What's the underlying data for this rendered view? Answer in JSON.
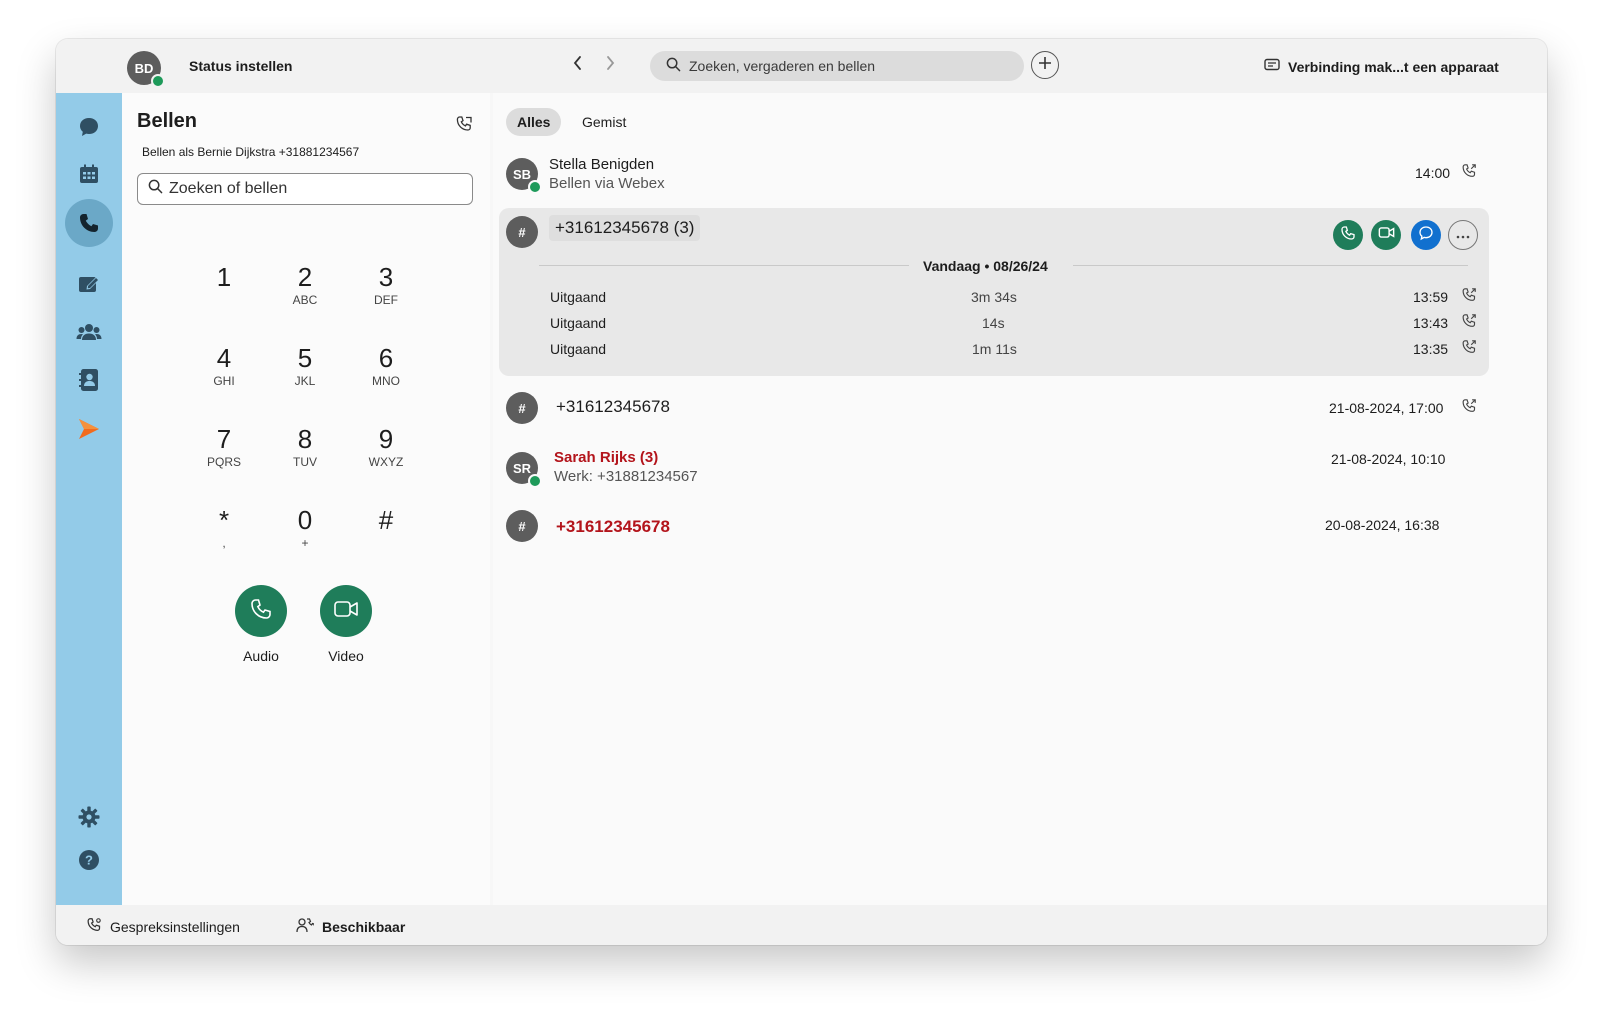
{
  "topbar": {
    "avatar_initials": "BD",
    "status_label": "Status instellen",
    "search_placeholder": "Zoeken, vergaderen en bellen",
    "connect_label": "Verbinding mak...t een apparaat"
  },
  "rail": {
    "items": [
      "messaging-icon",
      "calendar-icon",
      "calling-icon",
      "whiteboard-icon",
      "teams-icon",
      "contacts-icon",
      "webex-app-icon",
      "settings-icon",
      "help-icon"
    ],
    "active": "calling-icon"
  },
  "dialer": {
    "title": "Bellen",
    "calling_as": "Bellen als Bernie Dijkstra +31881234567",
    "search_placeholder": "Zoeken of bellen",
    "keys": [
      {
        "digit": "1",
        "letters": ""
      },
      {
        "digit": "2",
        "letters": "ABC"
      },
      {
        "digit": "3",
        "letters": "DEF"
      },
      {
        "digit": "4",
        "letters": "GHI"
      },
      {
        "digit": "5",
        "letters": "JKL"
      },
      {
        "digit": "6",
        "letters": "MNO"
      },
      {
        "digit": "7",
        "letters": "PQRS"
      },
      {
        "digit": "8",
        "letters": "TUV"
      },
      {
        "digit": "9",
        "letters": "WXYZ"
      },
      {
        "digit": "*",
        "letters": ","
      },
      {
        "digit": "0",
        "letters": "+"
      },
      {
        "digit": "#",
        "letters": ""
      }
    ],
    "audio_label": "Audio",
    "video_label": "Video"
  },
  "history": {
    "tabs": [
      "Alles",
      "Gemist"
    ],
    "active_tab": "Alles",
    "entries": [
      {
        "avatar": "SB",
        "name": "Stella Benigden",
        "sub": "Bellen via Webex",
        "time": "14:00",
        "missed": false
      },
      {
        "avatar": "#",
        "name": "+31612345678 (3)",
        "time": "",
        "missed": false,
        "date_header": "Vandaag • 08/26/24",
        "details": [
          {
            "type": "Uitgaand",
            "duration": "3m 34s",
            "time": "13:59"
          },
          {
            "type": "Uitgaand",
            "duration": "14s",
            "time": "13:43"
          },
          {
            "type": "Uitgaand",
            "duration": "1m 11s",
            "time": "13:35"
          }
        ]
      },
      {
        "avatar": "#",
        "name": "+31612345678",
        "time": "21-08-2024, 17:00",
        "missed": false
      },
      {
        "avatar": "SR",
        "name": "Sarah Rijks (3)",
        "sub": "Werk: +31881234567",
        "time": "21-08-2024, 10:10",
        "missed": true
      },
      {
        "avatar": "#",
        "name": "+31612345678",
        "time": "20-08-2024, 16:38",
        "missed": true
      }
    ]
  },
  "footer": {
    "call_settings": "Gespreksinstellingen",
    "availability": "Beschikbaar"
  },
  "colors": {
    "rail": "#93cbe8",
    "call_green": "#1f7d5a",
    "chat_blue": "#1170cf",
    "missed_red": "#b3141b"
  }
}
